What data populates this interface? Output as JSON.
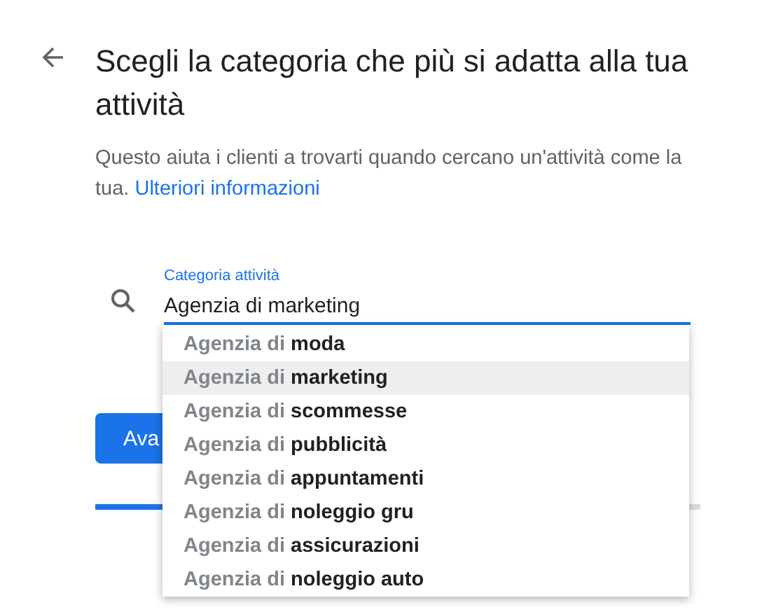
{
  "header": {
    "title": "Scegli la categoria che più si adatta alla tua attività",
    "description": "Questo aiuta i clienti a trovarti quando cercano un'attività come la tua.",
    "link": "Ulteriori informazioni"
  },
  "field": {
    "label": "Categoria attività",
    "value": "Agenzia di marketing"
  },
  "suggestions": [
    {
      "text": "Agenzia di **moda**",
      "selected": false
    },
    {
      "text": "Agenzia di **marketing**",
      "selected": true
    },
    {
      "text": "Agenzia di **scommesse**",
      "selected": false
    },
    {
      "text": "Agenzia di **pubblicità**",
      "selected": false
    },
    {
      "text": "Agenzia di **appuntamenti**",
      "selected": false
    },
    {
      "text": "Agenzia di **noleggio gru**",
      "selected": false
    },
    {
      "text": "Agenzia di **assicurazioni**",
      "selected": false
    },
    {
      "text": "Agenzia di **noleggio auto**",
      "selected": false
    }
  ],
  "button": {
    "label": "Ava"
  },
  "progress": {
    "level": 0.12
  }
}
